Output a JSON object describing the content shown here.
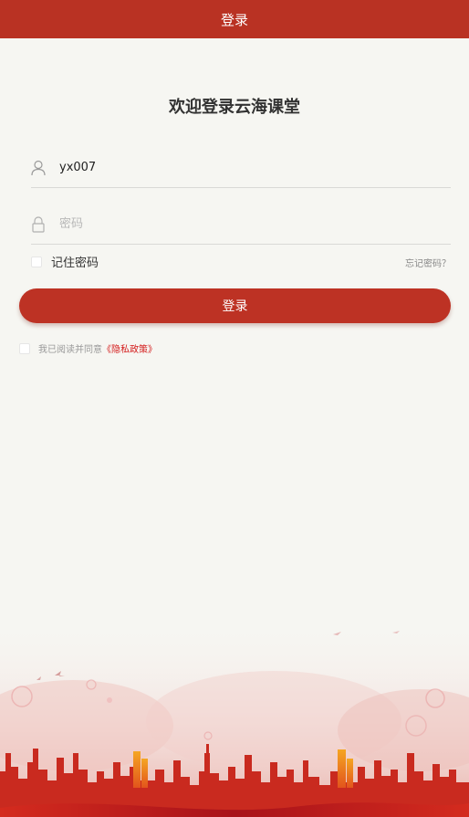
{
  "navbar": {
    "title": "登录"
  },
  "welcome": {
    "title": "欢迎登录云海课堂"
  },
  "form": {
    "username": {
      "value": "yx007",
      "icon": "user-icon"
    },
    "password": {
      "placeholder": "密码",
      "icon": "lock-icon"
    },
    "remember_label": "记住密码",
    "forgot_label": "忘记密码？",
    "login_label": "登录"
  },
  "agreement": {
    "prefix": "我已阅读并同意",
    "link": "《隐私政策》"
  },
  "colors": {
    "primary": "#b93223",
    "background": "#f6f6f2",
    "link": "#d41d1d"
  }
}
